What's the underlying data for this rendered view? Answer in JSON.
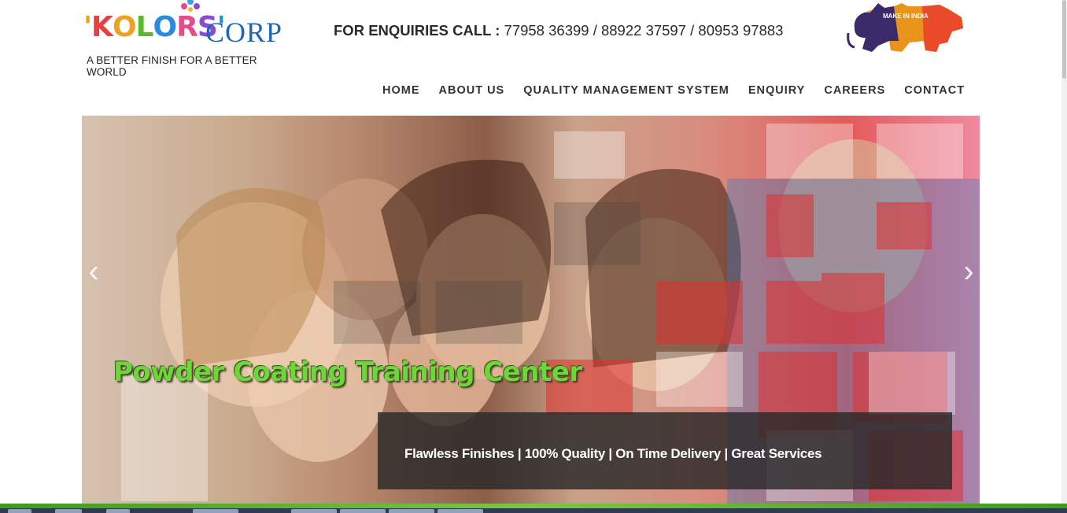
{
  "header": {
    "logo_left": "KOLORS",
    "logo_right": "CORP",
    "tagline": "A BETTER FINISH FOR A BETTER WORLD",
    "enquiry_label": "FOR ENQUIRIES CALL :",
    "enquiry_numbers": "77958 36399 / 88922 37597 / 80953 97883",
    "badge_text": "MAKE IN INDIA"
  },
  "nav": {
    "items": [
      {
        "label": "HOME",
        "active": true
      },
      {
        "label": "ABOUT US"
      },
      {
        "label": "QUALITY MANAGEMENT SYSTEM"
      },
      {
        "label": "ENQUIRY"
      },
      {
        "label": "CAREERS"
      },
      {
        "label": "CONTACT"
      }
    ]
  },
  "slider": {
    "title": "Powder Coating Training Center",
    "caption": "Flawless Finishes | 100% Quality | On Time Delivery | Great Services",
    "prev_icon": "chevron-left-icon",
    "next_icon": "chevron-right-icon"
  },
  "colors": {
    "accent": "#2a6fb5",
    "title_green": "#6cd63a",
    "footer_green": "#7cc548"
  }
}
